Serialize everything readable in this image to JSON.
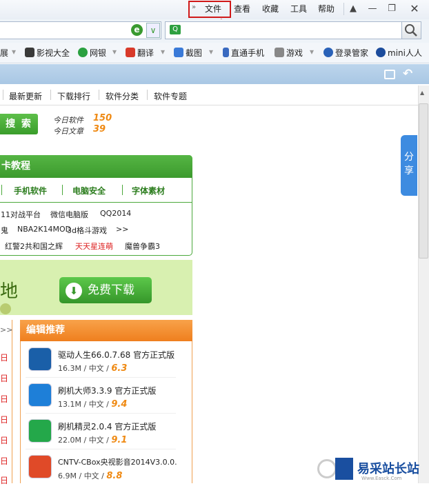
{
  "titlebar": {
    "chevron": "»",
    "menu": [
      "文件",
      "查看",
      "收藏",
      "工具",
      "帮助"
    ],
    "buttons": [
      "shirt-icon",
      "minimize-icon",
      "restore-icon",
      "close-icon"
    ]
  },
  "favorites": [
    "展",
    "影视大全",
    "网银",
    "翻译",
    "截图",
    "直通手机",
    "游戏",
    "登录管家",
    "mini人人"
  ],
  "nav": [
    "最新更新",
    "下载排行",
    "软件分类",
    "软件专题"
  ],
  "search_button": "搜 索",
  "stats": {
    "today_software_label": "今日软件",
    "today_software_value": "150",
    "today_article_label": "今日文章",
    "today_article_value": "39"
  },
  "share": "分享",
  "tutorial": {
    "title": "卡教程",
    "categories": [
      "手机软件",
      "电脑安全",
      "字体素材"
    ],
    "links": [
      [
        "11对战平台",
        "微信电脑版",
        "QQ2014"
      ],
      [
        "鬼",
        "NBA2K14MOD",
        "3d格斗游戏",
        ">>"
      ],
      [
        "红警2共和国之辉",
        "天天星连萌",
        "魔兽争霸3"
      ]
    ]
  },
  "banner": {
    "text": "地",
    "button": "免费下载"
  },
  "left_col": {
    "arrow": ">>",
    "chars": [
      "日",
      "日",
      "日",
      "日",
      "日",
      "日",
      "日",
      "日"
    ]
  },
  "editor": {
    "title": "编辑推荐",
    "apps": [
      {
        "name": "驱动人生66.0.7.68 官方正式版",
        "size": "16.3M",
        "lang": "中文",
        "score": "6.3",
        "color": "#1a5fa8"
      },
      {
        "name": "刷机大师3.3.9 官方正式版",
        "size": "13.1M",
        "lang": "中文",
        "score": "9.4",
        "color": "#1e7fd8"
      },
      {
        "name": "刷机精灵2.0.4 官方正式版",
        "size": "22.0M",
        "lang": "中文",
        "score": "9.1",
        "color": "#24a84a"
      },
      {
        "name": "CNTV-CBox央视影音2014V3.0.0.",
        "size": "6.9M",
        "lang": "中文",
        "score": "8.8",
        "color": "#e04a28"
      }
    ]
  },
  "watermark": {
    "text": "易采站长站",
    "sub": "Www.Easck.Com"
  },
  "colors": {
    "highlight": "#d01818",
    "accent_green": "#3c9a2d",
    "accent_orange": "#ef7f1e"
  }
}
